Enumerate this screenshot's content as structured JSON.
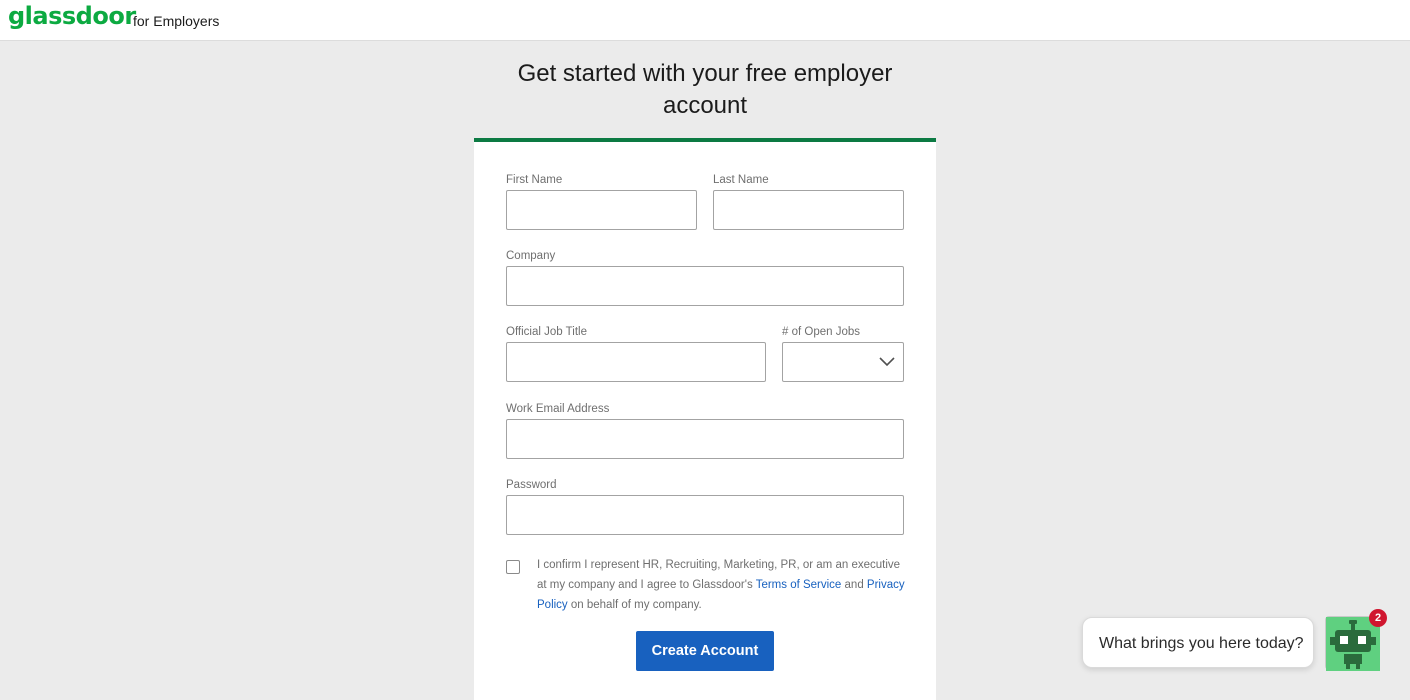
{
  "header": {
    "logo_text": "glassdoor",
    "logo_sub": "for Employers",
    "brand_color": "#0caa41"
  },
  "page": {
    "headline": "Get started with your free employer account"
  },
  "form": {
    "first_name": {
      "label": "First Name",
      "value": ""
    },
    "last_name": {
      "label": "Last Name",
      "value": ""
    },
    "company": {
      "label": "Company",
      "value": ""
    },
    "job_title": {
      "label": "Official Job Title",
      "value": ""
    },
    "open_jobs": {
      "label": "# of Open Jobs",
      "selected": ""
    },
    "email": {
      "label": "Work Email Address",
      "value": ""
    },
    "password": {
      "label": "Password",
      "value": ""
    },
    "consent": {
      "text_before": "I confirm I represent HR, Recruiting, Marketing, PR, or am an executive at my company and I agree to Glassdoor's ",
      "terms_link": "Terms of Service",
      "text_and": " and ",
      "privacy_link": "Privacy Policy",
      "text_after": " on behalf of my company."
    },
    "submit_label": "Create Account",
    "accent_color": "#1861bf"
  },
  "chat": {
    "prompt": "What brings you here today?",
    "badge_count": "2",
    "icon": "robot-icon"
  }
}
